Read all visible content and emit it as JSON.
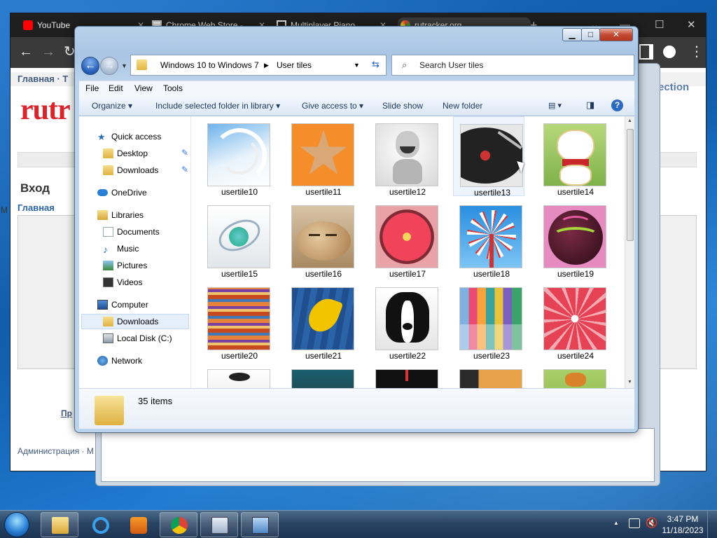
{
  "chrome": {
    "tabs": [
      {
        "label": "YouTube"
      },
      {
        "label": "Chrome Web Store -"
      },
      {
        "label": "Multiplayer Piano"
      },
      {
        "label": "rutracker.org"
      }
    ],
    "new_tab_glyph": "+",
    "page": {
      "menu_left": "Главная · Т",
      "logo": "rutr",
      "login_heading": "Вход",
      "home_link": "Главная",
      "side_link": "Пр",
      "footer_link": "Администрация · М",
      "right_link": "ection",
      "m_letter": "M"
    }
  },
  "explorer": {
    "title_buttons": {
      "minimize": "▁",
      "maximize": "□",
      "close": "✕"
    },
    "address": {
      "segments": [
        "Windows 10 to Windows 7",
        "User tiles"
      ]
    },
    "search_placeholder": "Search User tiles",
    "menu": [
      "File",
      "Edit",
      "View",
      "Tools"
    ],
    "commands": [
      "Organize",
      "Include selected folder in library",
      "Give access to",
      "Slide show",
      "New folder"
    ],
    "nav": {
      "quick_access": "Quick access",
      "desktop": "Desktop",
      "downloads_pinned": "Downloads",
      "onedrive": "OneDrive",
      "libraries": "Libraries",
      "documents": "Documents",
      "music": "Music",
      "pictures": "Pictures",
      "videos": "Videos",
      "computer": "Computer",
      "downloads": "Downloads",
      "local_disk": "Local Disk (C:)",
      "network": "Network"
    },
    "files": [
      {
        "name": "usertile10"
      },
      {
        "name": "usertile11"
      },
      {
        "name": "usertile12"
      },
      {
        "name": "usertile13"
      },
      {
        "name": "usertile14"
      },
      {
        "name": "usertile15"
      },
      {
        "name": "usertile16"
      },
      {
        "name": "usertile17"
      },
      {
        "name": "usertile18"
      },
      {
        "name": "usertile19"
      },
      {
        "name": "usertile20"
      },
      {
        "name": "usertile21"
      },
      {
        "name": "usertile22"
      },
      {
        "name": "usertile23"
      },
      {
        "name": "usertile24"
      }
    ],
    "status": "35 items"
  },
  "taskbar": {
    "time": "3:47 PM",
    "date": "11/18/2023",
    "tray_arrow": "▲"
  },
  "colors": {
    "accent": "#2c6ac2",
    "taskbar": "#1d3452",
    "rutracker_red": "#d8262c"
  }
}
